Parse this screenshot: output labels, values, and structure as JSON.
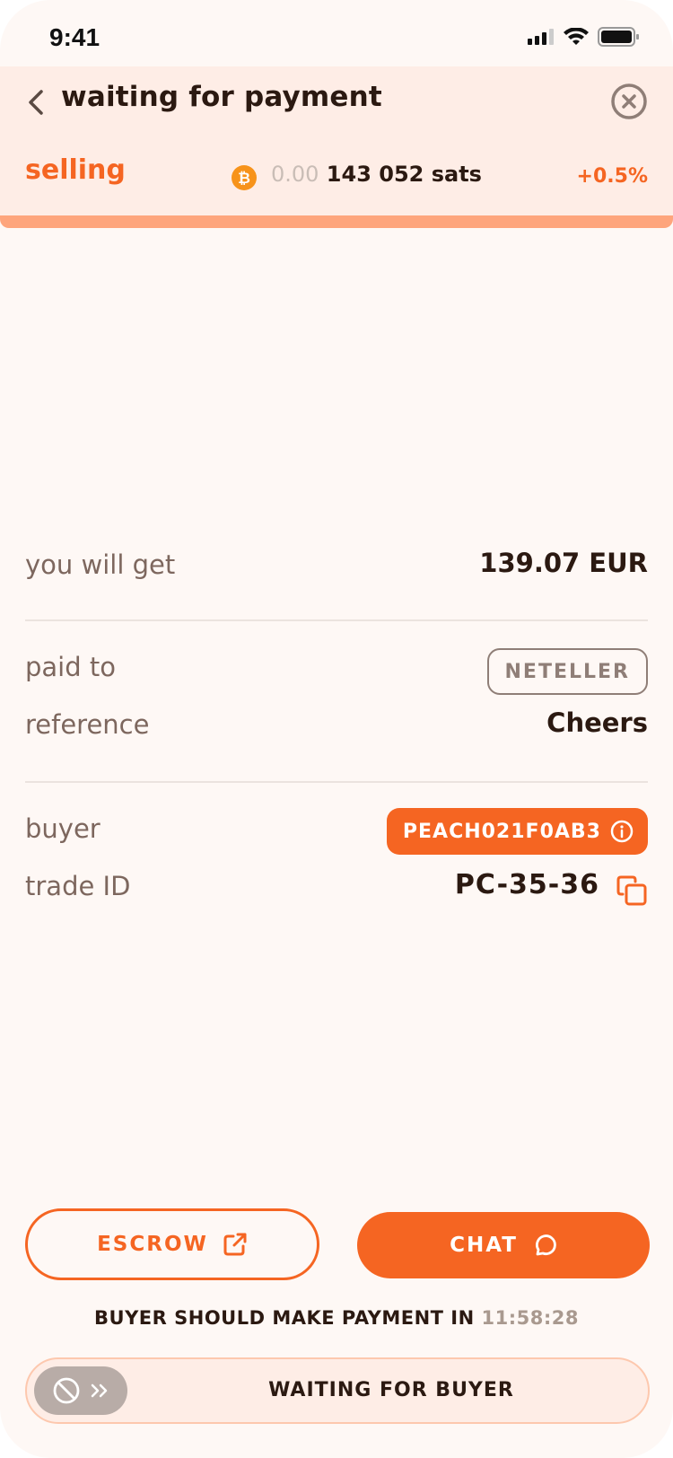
{
  "status_bar": {
    "time": "9:41",
    "icons": [
      "signal-icon",
      "wifi-icon",
      "battery-icon"
    ]
  },
  "header": {
    "title": "waiting for payment",
    "back_icon": "chevron-left-icon",
    "close_icon": "close-circle-icon",
    "trade_type": "selling",
    "amount_prefix": "0.00",
    "amount": "143 052",
    "amount_unit": "sats",
    "premium": "+0.5%",
    "progress_fraction": 1.0
  },
  "details": {
    "you_will_get": {
      "label": "you will get",
      "value": "139.07 EUR"
    },
    "paid_to": {
      "label": "paid to",
      "value": "NETELLER"
    },
    "reference": {
      "label": "reference",
      "value": "Cheers"
    },
    "buyer": {
      "label": "buyer",
      "value": "PEACH021F0AB3"
    },
    "trade_id": {
      "label": "trade ID",
      "value": "PC-35-36"
    }
  },
  "actions": {
    "escrow_label": "ESCROW",
    "chat_label": "CHAT"
  },
  "deadline": {
    "text": "BUYER SHOULD MAKE PAYMENT IN",
    "timer": "11:58:28"
  },
  "slider": {
    "label": "WAITING FOR BUYER",
    "disabled": true
  },
  "colors": {
    "accent": "#f56522",
    "header_bg": "#feede6",
    "background": "#fef8f5",
    "text": "#2b1911",
    "muted": "#7d675e"
  }
}
